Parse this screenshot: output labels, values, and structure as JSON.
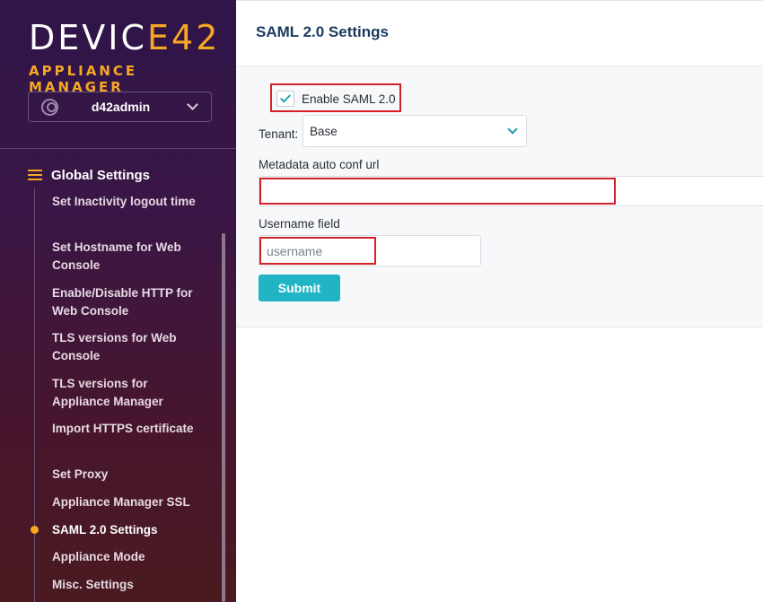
{
  "brand": {
    "logo_prefix": "DEVIC",
    "logo_accent_char": "E",
    "logo_suffix": "42",
    "subtitle": "APPLIANCE MANAGER",
    "accent_color": "#f7a823"
  },
  "user": {
    "name": "d42admin",
    "avatar_icon": "user-circle-icon",
    "dropdown_icon": "chevron-down-icon"
  },
  "sidebar": {
    "section_icon": "sliders-icon",
    "section_title": "Global Settings",
    "items": [
      {
        "label": "Set Inactivity logout time",
        "active": false
      },
      {
        "label": "Set Hostname for Web Console",
        "active": false
      },
      {
        "label": "Enable/Disable HTTP for Web Console",
        "active": false
      },
      {
        "label": "TLS versions for Web Console",
        "active": false
      },
      {
        "label": "TLS versions for Appliance Manager",
        "active": false
      },
      {
        "label": "Import HTTPS certificate",
        "active": false
      },
      {
        "label": "Set Proxy",
        "active": false
      },
      {
        "label": "Appliance Manager SSL",
        "active": false
      },
      {
        "label": "SAML 2.0 Settings",
        "active": true
      },
      {
        "label": "Appliance Mode",
        "active": false
      },
      {
        "label": "Misc. Settings",
        "active": false
      }
    ]
  },
  "main": {
    "title": "SAML 2.0 Settings",
    "enable_saml": {
      "label": "Enable SAML 2.0",
      "checked": true
    },
    "tenant": {
      "label": "Tenant:",
      "value": "Base"
    },
    "metadata_url": {
      "label": "Metadata auto conf url",
      "value": ""
    },
    "username_field": {
      "label": "Username field",
      "placeholder": "username"
    },
    "submit_label": "Submit",
    "button_color": "#20b4c4",
    "highlight_color": "#d42027"
  }
}
